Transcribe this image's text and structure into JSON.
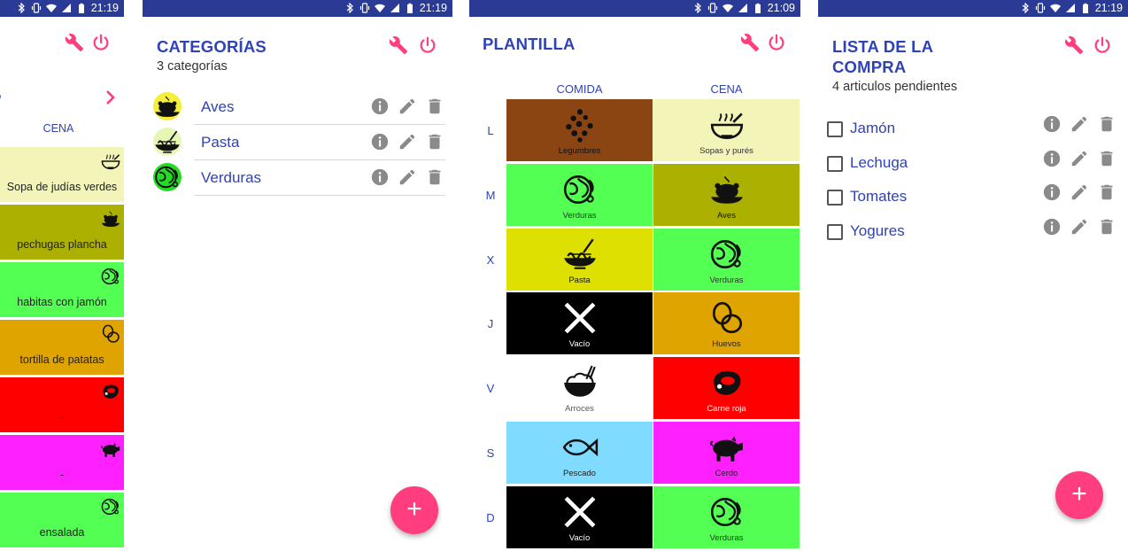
{
  "status_bar": {
    "times": [
      "21:19",
      "21:19",
      "21:09",
      "21:19"
    ]
  },
  "colors": {
    "accent": "#ff3d7f",
    "title_blue": "#2f43b7",
    "status_bar": "#2a3a95"
  },
  "screen1": {
    "header_label": "CENA",
    "meals": [
      {
        "label": "Sopa de judías verdes",
        "icon": "soup-icon",
        "color": "#f3f5b8"
      },
      {
        "label": "pechugas plancha",
        "icon": "roast-chicken-icon",
        "color": "#acb000"
      },
      {
        "label": "habitas con jamón",
        "icon": "vegetable-icon",
        "color": "#52ff52"
      },
      {
        "label": "tortilla de patatas",
        "icon": "eggs-icon",
        "color": "#dfa400"
      },
      {
        "label": "-",
        "icon": "steak-icon",
        "color": "#ff0000"
      },
      {
        "label": "-",
        "icon": "pig-icon",
        "color": "#ff20ff"
      },
      {
        "label": "ensalada",
        "icon": "vegetable-icon",
        "color": "#52ff52"
      }
    ]
  },
  "screen2": {
    "title": "CATEGORÍAS",
    "subtitle": "3 categorías",
    "categories": [
      {
        "name": "Aves",
        "icon": "roast-chicken-icon",
        "color": "#f5ee3a"
      },
      {
        "name": "Pasta",
        "icon": "pasta-icon",
        "color": "#e6f7b5"
      },
      {
        "name": "Verduras",
        "icon": "vegetable-icon",
        "color": "#23dc23"
      }
    ],
    "fab_label": "+"
  },
  "screen3": {
    "title": "PLANTILLA",
    "columns": [
      "COMIDA",
      "CENA"
    ],
    "days": [
      {
        "day": "L",
        "comida": {
          "label": "Legumbres",
          "icon": "legumes-icon",
          "bg": "#8b4513",
          "fg": "#111111"
        },
        "cena": {
          "label": "Sopas y purés",
          "icon": "soup-icon",
          "bg": "#f3f5b8",
          "fg": "#333333"
        }
      },
      {
        "day": "M",
        "comida": {
          "label": "Verduras",
          "icon": "vegetable-icon",
          "bg": "#52ff52",
          "fg": "#333333"
        },
        "cena": {
          "label": "Aves",
          "icon": "roast-chicken-icon",
          "bg": "#acb000",
          "fg": "#111111"
        }
      },
      {
        "day": "X",
        "comida": {
          "label": "Pasta",
          "icon": "pasta-icon",
          "bg": "#dde000",
          "fg": "#111111"
        },
        "cena": {
          "label": "Verduras",
          "icon": "vegetable-icon",
          "bg": "#52ff52",
          "fg": "#333333"
        }
      },
      {
        "day": "J",
        "comida": {
          "label": "Vacío",
          "icon": "cross-icon",
          "bg": "#000000",
          "fg": "#ffffff"
        },
        "cena": {
          "label": "Huevos",
          "icon": "eggs-icon",
          "bg": "#dfa400",
          "fg": "#222222"
        }
      },
      {
        "day": "V",
        "comida": {
          "label": "Arroces",
          "icon": "rice-bowl-icon",
          "bg": "#ffffff",
          "fg": "#555555"
        },
        "cena": {
          "label": "Carne roja",
          "icon": "steak-icon",
          "bg": "#ff0000",
          "fg": "#ffffff"
        }
      },
      {
        "day": "S",
        "comida": {
          "label": "Pescado",
          "icon": "fish-icon",
          "bg": "#7fdbff",
          "fg": "#222222"
        },
        "cena": {
          "label": "Cerdo",
          "icon": "pig-icon",
          "bg": "#ff20ff",
          "fg": "#222222"
        }
      },
      {
        "day": "D",
        "comida": {
          "label": "Vacío",
          "icon": "cross-icon",
          "bg": "#000000",
          "fg": "#ffffff"
        },
        "cena": {
          "label": "Verduras",
          "icon": "vegetable-icon",
          "bg": "#52ff52",
          "fg": "#333333"
        }
      }
    ]
  },
  "screen4": {
    "title_line1": "LISTA DE LA",
    "title_line2": "COMPRA",
    "subtitle": "4 articulos pendientes",
    "items": [
      {
        "name": "Jamón",
        "checked": false
      },
      {
        "name": "Lechuga",
        "checked": false
      },
      {
        "name": "Tomates",
        "checked": false
      },
      {
        "name": "Yogures",
        "checked": false
      }
    ],
    "fab_label": "+"
  }
}
